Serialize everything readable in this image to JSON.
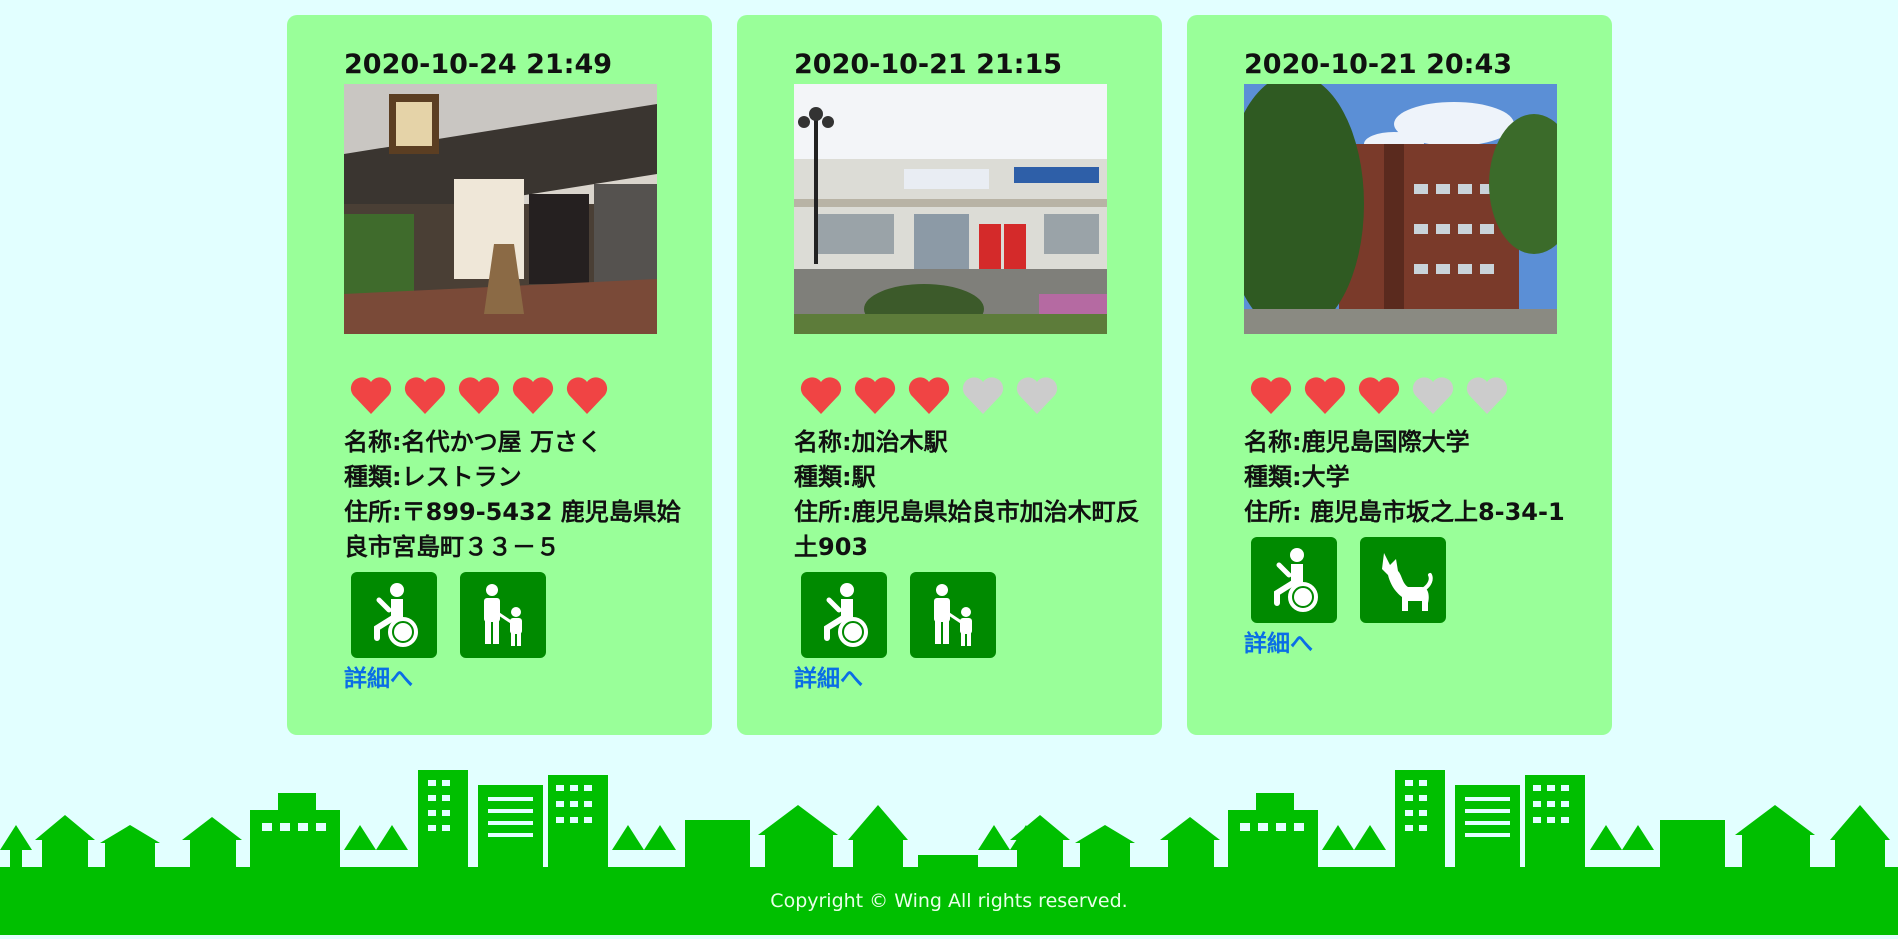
{
  "colors": {
    "background": "#e2ffff",
    "card": "#99ff99",
    "heart_on": "#f04444",
    "heart_off": "#cccccc",
    "facility_bg": "#008a00",
    "link": "#0a6ee6",
    "footer": "#00bf00"
  },
  "cards": [
    {
      "date": "2020-10-24 21:49",
      "photo": "restaurant-photo",
      "rating": 5,
      "name": "名称:名代かつ屋 万さく",
      "type": "種類:レストラン",
      "address": "住所:〒899-5432 鹿児島県姶良市宮島町３３－５",
      "facilities": [
        "wheelchair-icon",
        "parent-child-icon"
      ],
      "link": "詳細へ"
    },
    {
      "date": "2020-10-21 21:15",
      "photo": "station-photo",
      "rating": 3,
      "name": "名称:加治木駅",
      "type": "種類:駅",
      "address": "住所:鹿児島県姶良市加治木町反土903",
      "facilities": [
        "wheelchair-icon",
        "parent-child-icon"
      ],
      "link": "詳細へ"
    },
    {
      "date": "2020-10-21 20:43",
      "photo": "university-photo",
      "rating": 3,
      "name": "名称:鹿児島国際大学",
      "type": "種類:大学",
      "address": "住所: 鹿児島市坂之上8-34-1",
      "facilities": [
        "wheelchair-icon",
        "dog-icon"
      ],
      "link": "詳細へ"
    }
  ],
  "footer": {
    "copyright": "Copyright © Wing All rights reserved."
  }
}
